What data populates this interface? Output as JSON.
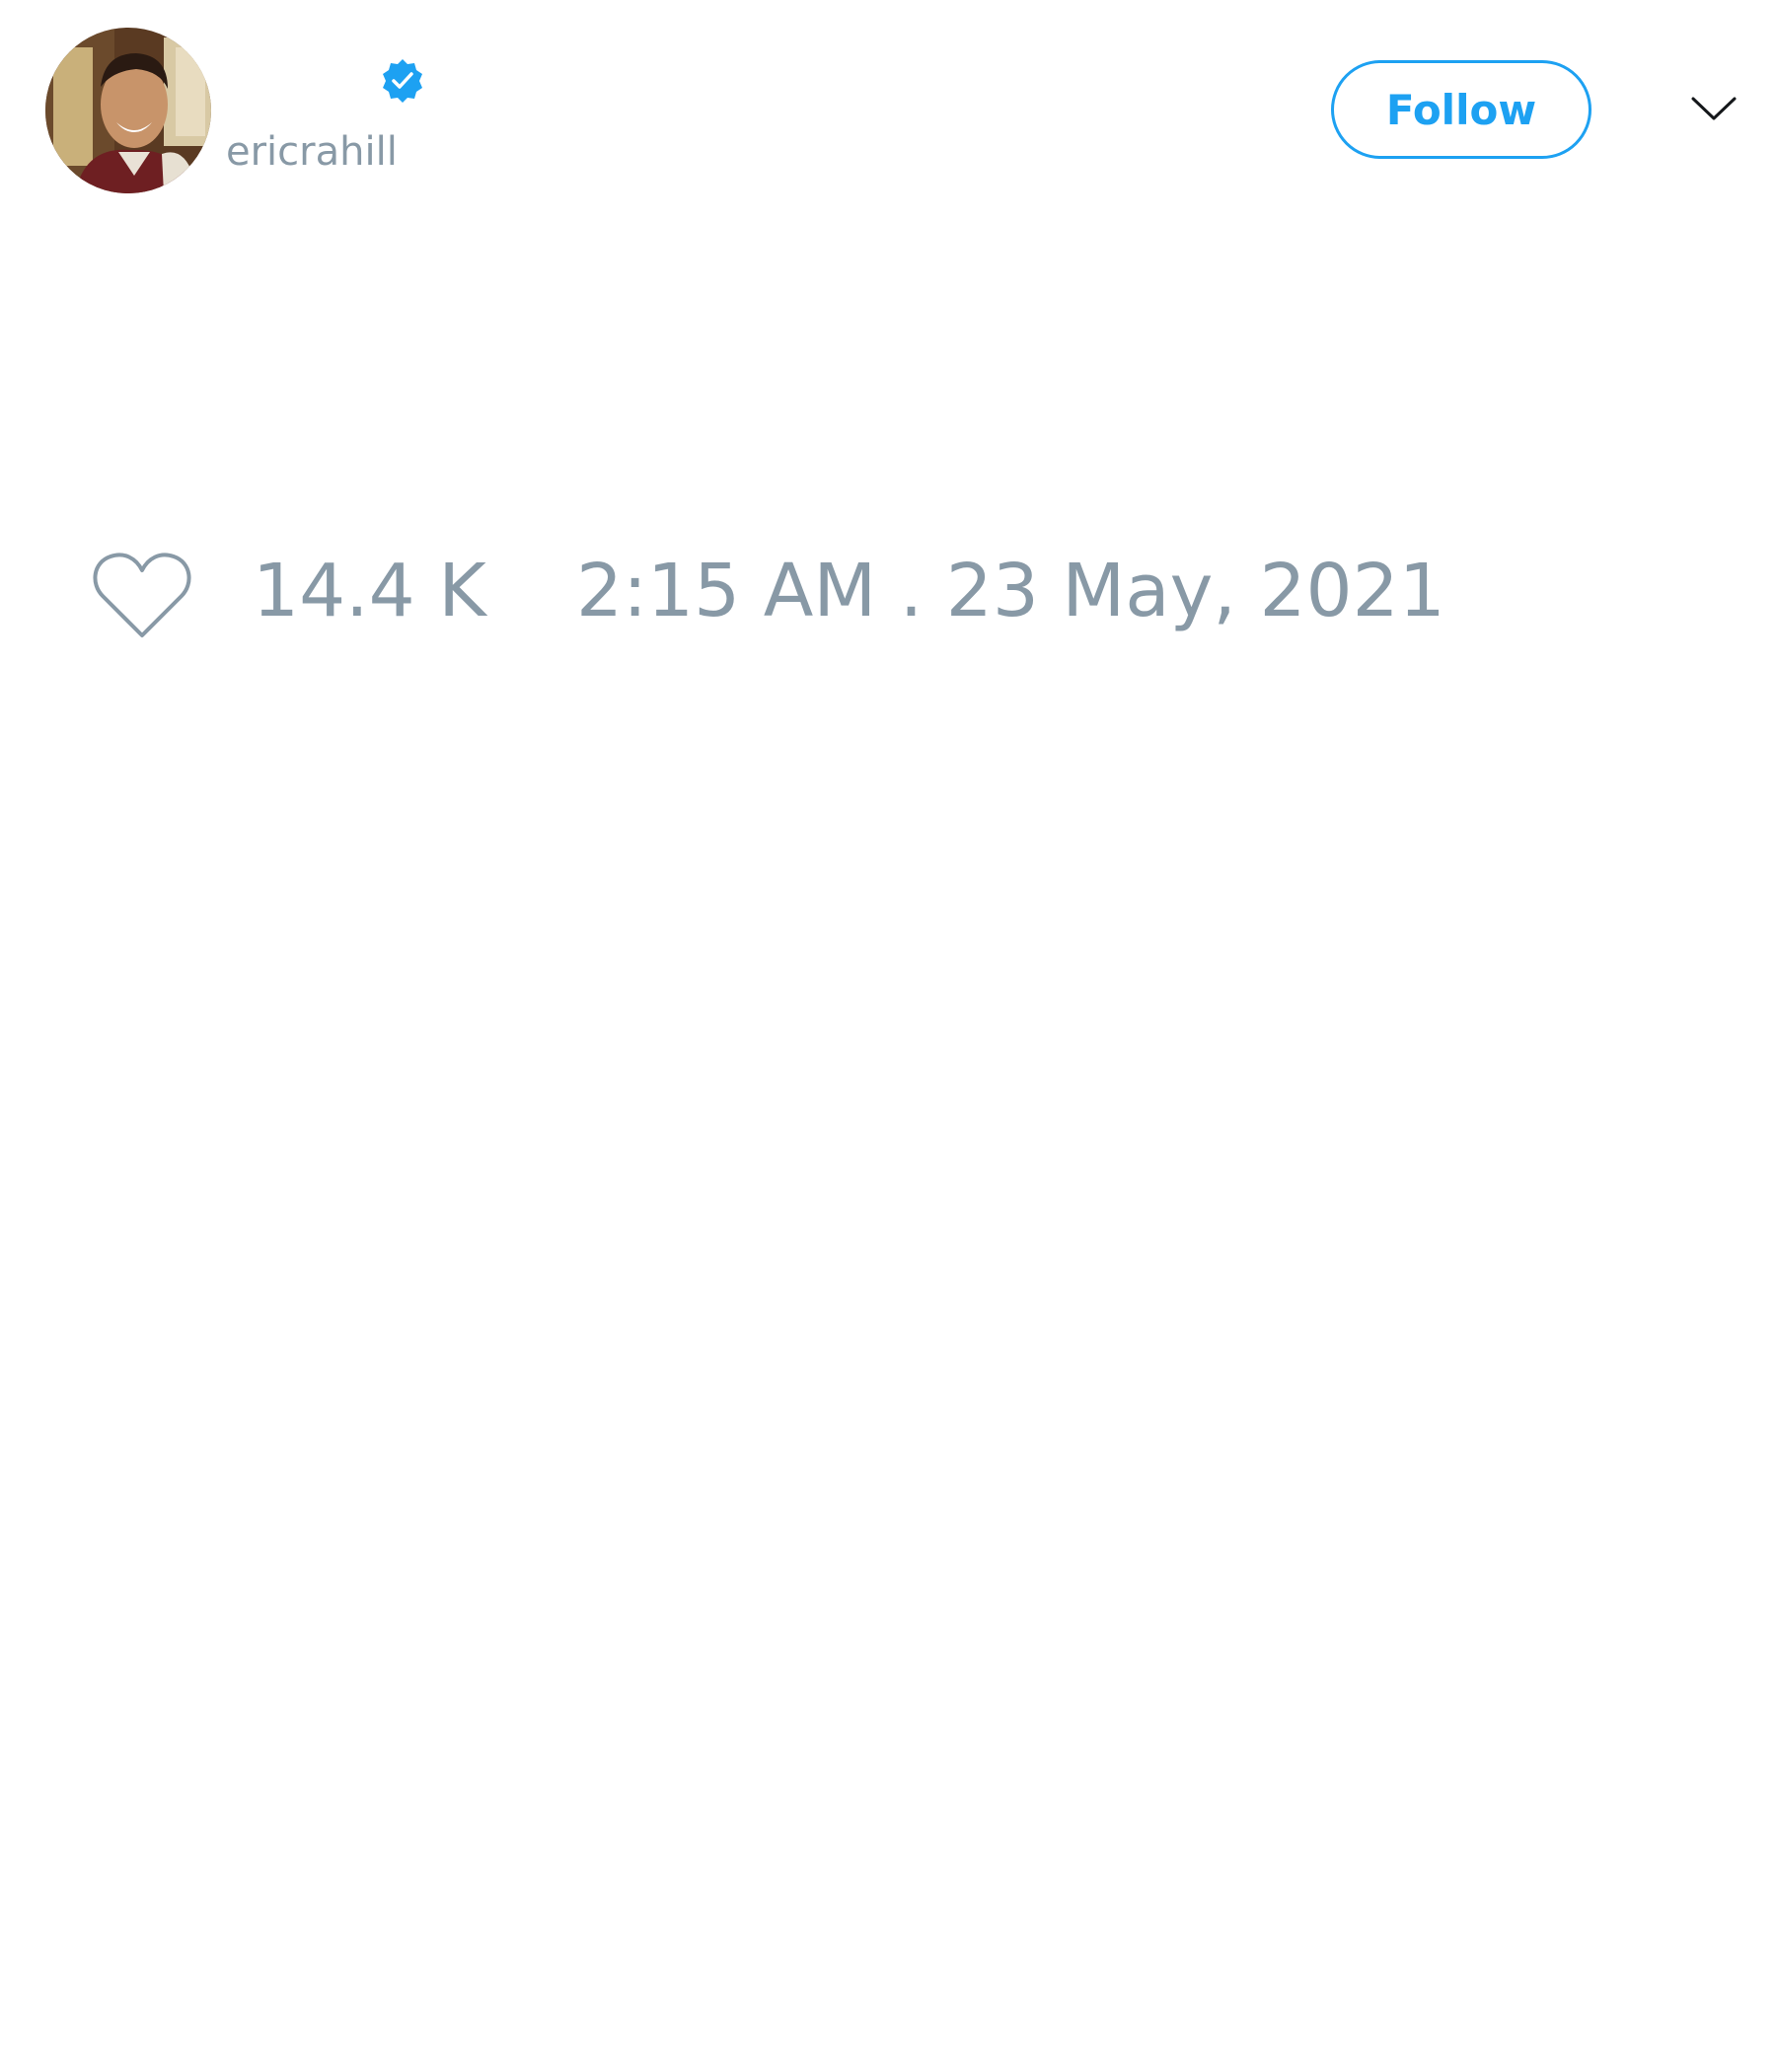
{
  "tweet": {
    "author": {
      "display_name": "",
      "handle": "ericrahill",
      "verified": true,
      "avatar_icon": "avatar-photo"
    },
    "follow_label": "Follow",
    "menu_icon": "chevron-down-icon",
    "like_icon": "heart-icon",
    "like_count": "14.4 K",
    "timestamp": "2:15 AM . 23 May, 2021"
  },
  "colors": {
    "accent": "#1da1f2",
    "muted_text": "#8899a6",
    "background": "#ffffff"
  }
}
